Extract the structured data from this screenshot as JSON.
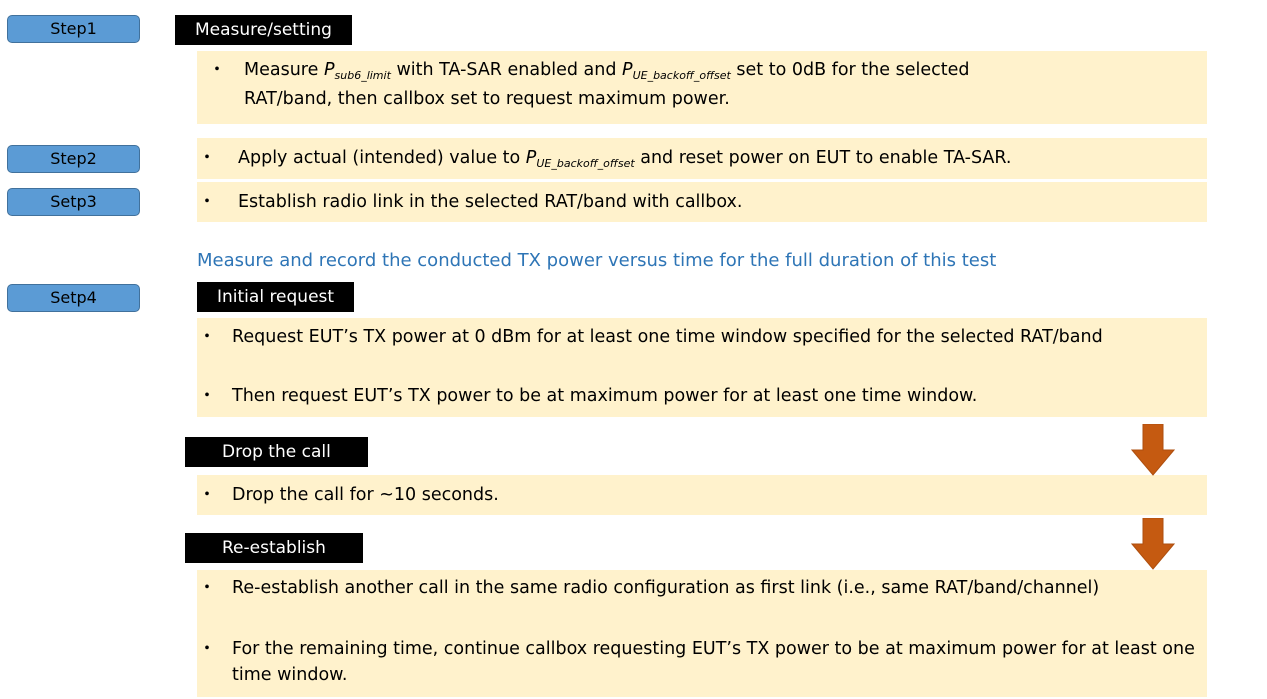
{
  "steps": [
    {
      "label": "Step1"
    },
    {
      "label": "Step2"
    },
    {
      "label": "Setp3"
    },
    {
      "label": "Setp4"
    }
  ],
  "step1": {
    "tag": "Measure/setting",
    "bullet": "・",
    "p1": "Measure ",
    "p_var": "P",
    "p_sub": "sub6_limit",
    "p2": " with TA-SAR enabled and ",
    "ue_var": "P",
    "ue_sub": "UE_backoff_offset",
    "p3": " set to 0dB for the selected",
    "line2": "RAT/band, then callbox set to request maximum power."
  },
  "step2": {
    "bullet": "・",
    "p1": "Apply actual (intended) value to ",
    "ue_var": "P",
    "ue_sub": "UE_backoff_offset",
    "p2": " and reset power on EUT to enable TA-SAR."
  },
  "step3": {
    "bullet": "・",
    "text": "Establish radio link in the selected RAT/band with callbox."
  },
  "caption": "Measure and record the conducted TX power versus time for the full duration of this test",
  "initial": {
    "tag": "Initial request",
    "bullet": "・",
    "items": [
      "Request EUT’s TX power at 0 dBm for at least one time window specified for the selected RAT/band",
      "Then request EUT’s TX power to be at maximum power for at least one time window."
    ]
  },
  "drop": {
    "tag": "Drop the call",
    "bullet": "・",
    "items": [
      "Drop the call for ~10 seconds."
    ]
  },
  "reestablish": {
    "tag": "Re-establish",
    "bullet": "・",
    "items": [
      "Re-establish another call in the same radio configuration as first link (i.e., same RAT/band/channel)",
      "For the remaining time, continue callbox requesting EUT’s TX power to be at maximum power for at least one time window."
    ]
  },
  "colors": {
    "step_button": "#5b9bd5",
    "box_fill": "#fff2cc",
    "caption": "#2e75b6",
    "arrow": "#c55a11"
  }
}
